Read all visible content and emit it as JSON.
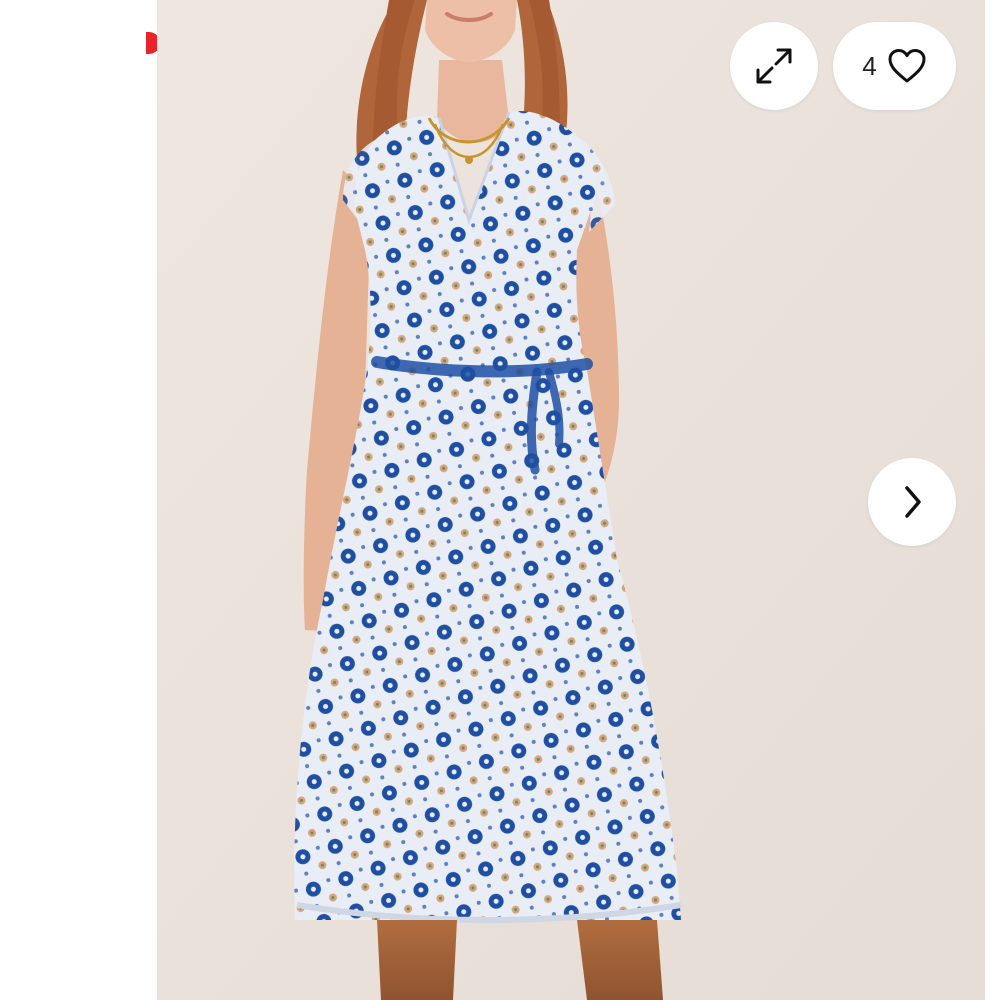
{
  "gallery": {
    "like_count": "4",
    "icons": {
      "expand": "expand-icon",
      "like": "heart-outline-icon",
      "next": "chevron-right-icon"
    },
    "colors": {
      "background": "#ede4de",
      "dress_base": "#e9edf5",
      "dress_pattern": "#1e4fa3",
      "accent_badge": "#e8232a"
    }
  }
}
